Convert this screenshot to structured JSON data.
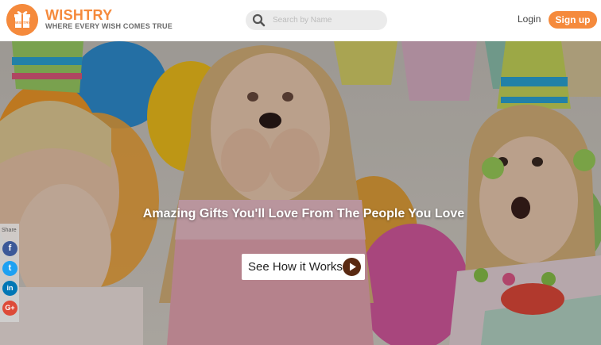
{
  "brand": {
    "name": "WISHTRY",
    "tagline": "WHERE EVERY WISH COMES TRUE",
    "logo_text": "WISHTRY",
    "color": "#f58a3c"
  },
  "search": {
    "placeholder": "Search by Name",
    "icon": "search-icon"
  },
  "nav": {
    "login_label": "Login",
    "signup_label": "Sign up"
  },
  "hero": {
    "title": "Amazing Gifts You'll Love From The People You Love",
    "cta_label": "See How it Works",
    "cta_icon": "play-icon"
  },
  "share": {
    "label": "Share",
    "buttons": [
      {
        "icon": "facebook-icon",
        "glyph": "f",
        "color": "#3b5998"
      },
      {
        "icon": "twitter-icon",
        "glyph": "t",
        "color": "#1da1f2"
      },
      {
        "icon": "linkedin-icon",
        "glyph": "in",
        "color": "#0077b5"
      },
      {
        "icon": "google-plus-icon",
        "glyph": "G+",
        "color": "#dd4b39"
      }
    ]
  }
}
